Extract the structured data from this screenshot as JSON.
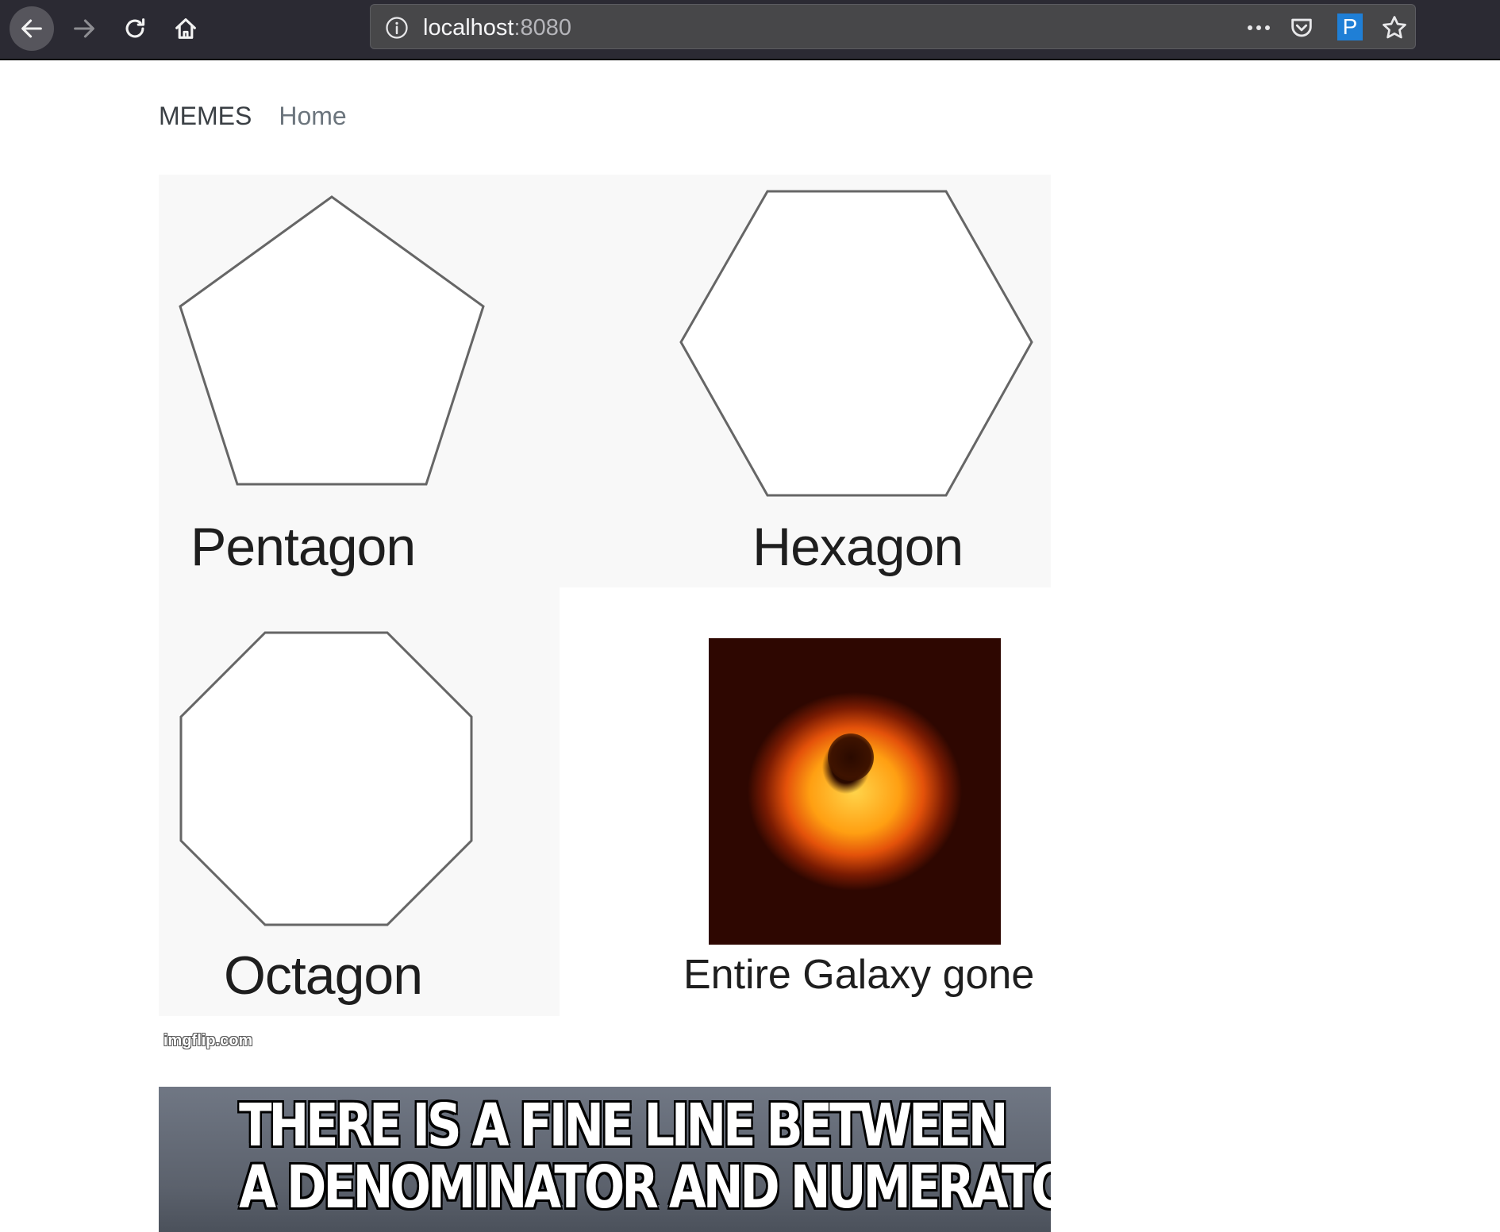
{
  "browser": {
    "url_host": "localhost",
    "url_port": ":8080",
    "extension_label": "P",
    "icons": {
      "back": "arrow-left-icon",
      "forward": "arrow-right-icon",
      "reload": "reload-icon",
      "home": "home-icon",
      "info": "info-icon",
      "more": "more-dots-icon",
      "pocket": "pocket-icon",
      "bookmark": "star-icon"
    }
  },
  "nav": {
    "brand": "MEMES",
    "home_link": "Home"
  },
  "memes": [
    {
      "labels": [
        "Pentagon",
        "Hexagon",
        "Octagon",
        "Entire Galaxy gone"
      ],
      "watermark": "imgflip.com"
    },
    {
      "lines": [
        "THERE IS A FINE LINE BETWEEN",
        "A DENOMINATOR AND NUMERATOR"
      ]
    }
  ],
  "colors": {
    "toolbar": "#2b2a33",
    "urlbar": "#474749",
    "extension_accent": "#1f7fd6",
    "nav_link": "#6c757d"
  }
}
